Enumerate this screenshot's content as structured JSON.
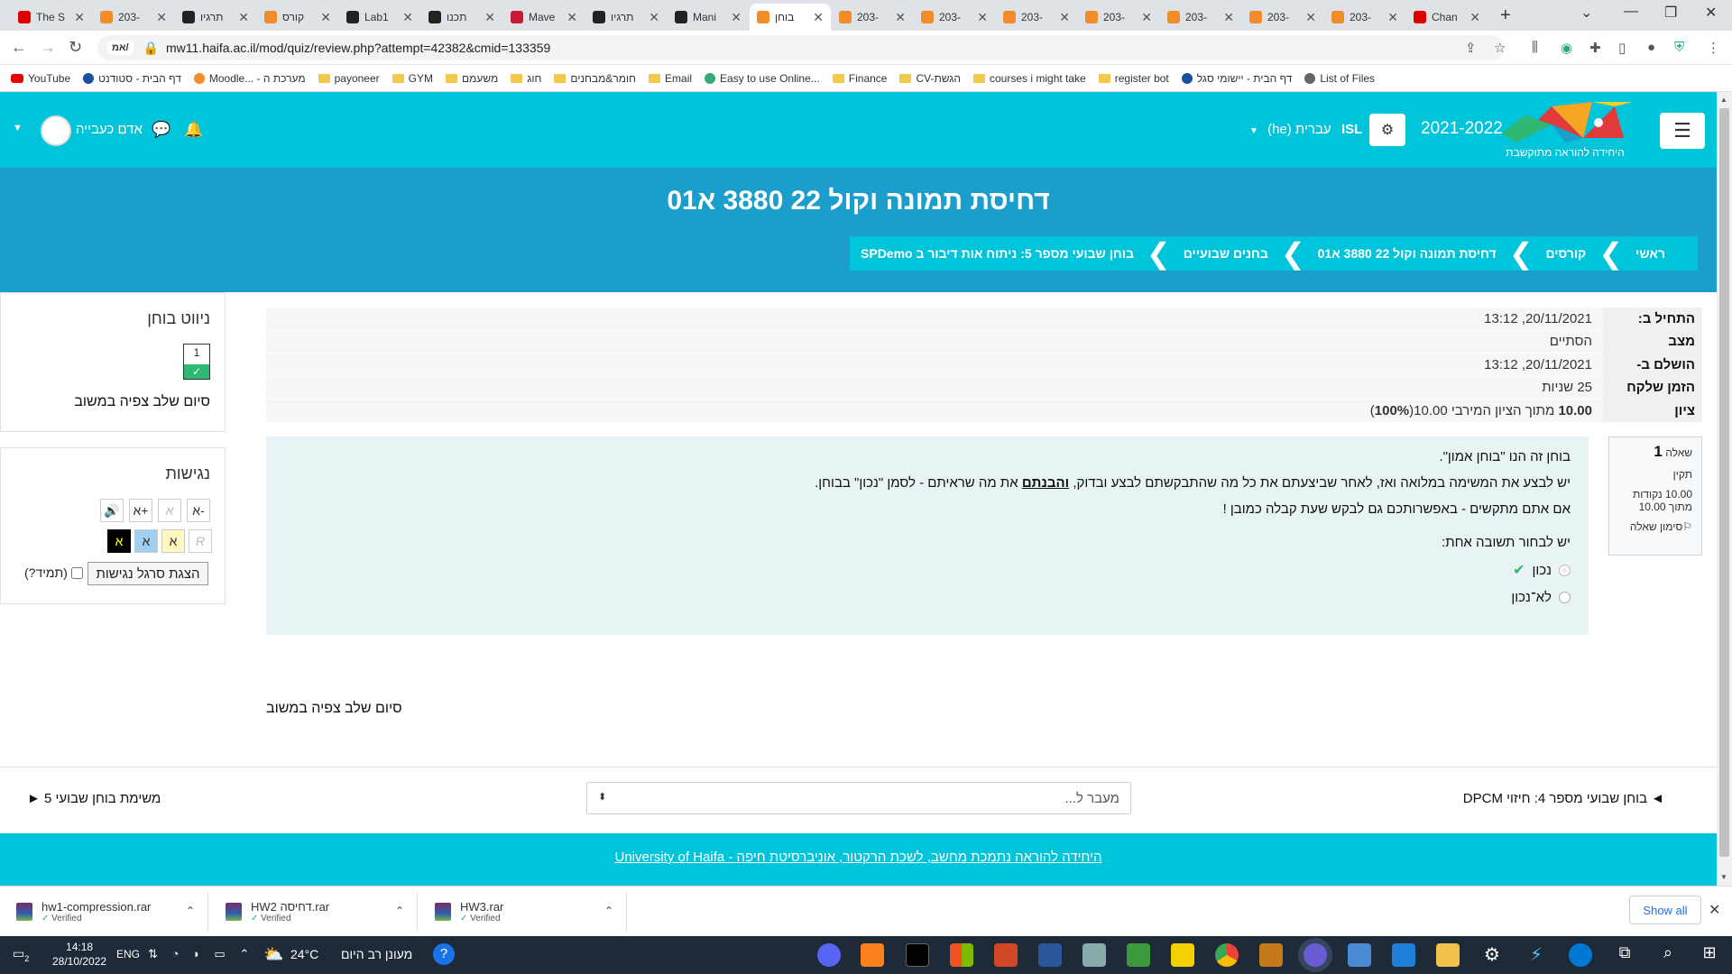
{
  "browser": {
    "tabs": [
      {
        "title": "The S",
        "icon": "youtube-icon",
        "color": "#e00000"
      },
      {
        "title": "203-",
        "icon": "moodle-icon",
        "color": "#f28c28"
      },
      {
        "title": "תרגיו",
        "icon": "github-icon",
        "color": "#222222"
      },
      {
        "title": "קורס",
        "icon": "moodle-icon",
        "color": "#f28c28"
      },
      {
        "title": "Lab1",
        "icon": "github-icon",
        "color": "#222222"
      },
      {
        "title": "תכנו",
        "icon": "github-icon",
        "color": "#222222"
      },
      {
        "title": "Mave",
        "icon": "maven-icon",
        "color": "#c71a36"
      },
      {
        "title": "תרגיו",
        "icon": "github-icon",
        "color": "#222222"
      },
      {
        "title": "Mani",
        "icon": "github-icon",
        "color": "#222222"
      },
      {
        "title": "בוחן",
        "icon": "moodle-icon",
        "color": "#f28c28",
        "active": true
      },
      {
        "title": "203-",
        "icon": "moodle-icon",
        "color": "#f28c28"
      },
      {
        "title": "203-",
        "icon": "moodle-icon",
        "color": "#f28c28"
      },
      {
        "title": "203-",
        "icon": "moodle-icon",
        "color": "#f28c28"
      },
      {
        "title": "203-",
        "icon": "moodle-icon",
        "color": "#f28c28"
      },
      {
        "title": "203-",
        "icon": "moodle-icon",
        "color": "#f28c28"
      },
      {
        "title": "203-",
        "icon": "moodle-icon",
        "color": "#f28c28"
      },
      {
        "title": "203-",
        "icon": "moodle-icon",
        "color": "#f28c28"
      },
      {
        "title": "Chan",
        "icon": "youtube-icon",
        "color": "#e00000"
      }
    ],
    "url": "mw11.haifa.ac.il/mod/quiz/review.php?attempt=42382&cmid=133359",
    "site_label": "אמ/",
    "bookmarks": [
      {
        "label": "YouTube",
        "icon": "youtube-icon"
      },
      {
        "label": "דף הבית - סטודנט",
        "icon": "haifa-icon"
      },
      {
        "label": "Moodle... - מערכת ה",
        "icon": "moodle-icon"
      },
      {
        "label": "payoneer",
        "icon": "folder-icon"
      },
      {
        "label": "GYM",
        "icon": "folder-icon"
      },
      {
        "label": "משעמם",
        "icon": "folder-icon"
      },
      {
        "label": "חוג",
        "icon": "folder-icon"
      },
      {
        "label": "חומר&מבחנים",
        "icon": "folder-icon"
      },
      {
        "label": "Email",
        "icon": "folder-icon"
      },
      {
        "label": "Easy to use Online...",
        "icon": "web-icon"
      },
      {
        "label": "Finance",
        "icon": "folder-icon"
      },
      {
        "label": "CV-הגשת",
        "icon": "folder-icon"
      },
      {
        "label": "courses i might take",
        "icon": "folder-icon"
      },
      {
        "label": "register bot",
        "icon": "folder-icon"
      },
      {
        "label": "דף הבית - יישומי סגל",
        "icon": "haifa-icon"
      },
      {
        "label": "List of Files",
        "icon": "globe-icon"
      }
    ]
  },
  "header": {
    "logo_text": "היחידה להוראה מתוקשבת",
    "year": "2021-2022",
    "isl": "ISL",
    "language": "עברית (he)",
    "username": "אדם כעבייה",
    "course_title": "דחיסת תמונה וקול 22 3880 א01",
    "breadcrumb": [
      "ראשי",
      "קורסים",
      "דחיסת תמונה וקול 22 3880 א01",
      "בחנים שבועיים",
      "בוחן שבועי מספר 5: ניתוח אות דיבור ב SPDemo"
    ]
  },
  "sidebar": {
    "nav_title": "ניווט בוחן",
    "question_number": "1",
    "finish_review": "סיום שלב צפיה במשוב",
    "accessibility_title": "נגישות",
    "font_minus": "א-",
    "font_plain": "א",
    "font_plus": "א+",
    "contrast": [
      "R",
      "א",
      "א",
      "א"
    ],
    "toolbar_button": "הצגת סרגל נגישות",
    "always_label": "(תמיד?)"
  },
  "summary": [
    {
      "label": "התחיל ב:",
      "value": "20/11/2021, 13:12"
    },
    {
      "label": "מצב",
      "value": "הסתיים"
    },
    {
      "label": "הושלם ב-",
      "value": "20/11/2021, 13:12"
    },
    {
      "label": "הזמן שלקח",
      "value": "25 שניות"
    },
    {
      "label": "ציון",
      "value_bold": "10.00",
      "value_rest": "מתוך הציון המירבי 10.00(",
      "value_pct": "100%",
      "value_end": ")"
    }
  ],
  "question": {
    "label": "שאלה",
    "number": "1",
    "status": "תקין",
    "marks": "10.00 נקודות",
    "marks_out_of": "מתוך 10.00",
    "flag": "סימון שאלה",
    "line1": "בוחן זה הנו \"בוחן אמון\".",
    "line2_a": "יש לבצע את המשימה במלואה ואז, לאחר שביצעתם את כל מה שהתבקשתם לבצע ובדוק, ",
    "line2_b": "והבנתם",
    "line2_c": " את מה שראיתם - לסמן \"נכון\" בבוחן.",
    "line3": "אם אתם מתקשים - באפשרותכם גם לבקש שעת קבלה כמובן !",
    "prompt": "יש לבחור תשובה אחת:",
    "options": [
      {
        "label": "נכון",
        "selected": true,
        "correct": true
      },
      {
        "label": "לא־נכון",
        "selected": false,
        "correct": false
      }
    ]
  },
  "finish_review": "סיום שלב צפיה במשוב",
  "activity_nav": {
    "prev": "◄ בוחן שבועי מספר 4: חיזוי DPCM",
    "jump_placeholder": "מעבר ל...",
    "next": "משימת בוחן שבועי 5 ►"
  },
  "footer": "היחידה להוראה נתמכת מחשב, לשכת הרקטור, אוניברסיטת חיפה - University of Haifa",
  "downloads": [
    {
      "name": "hw1-compression.rar",
      "status": "Verified"
    },
    {
      "name": "HW2 דחיסה.rar",
      "status": "Verified"
    },
    {
      "name": "HW3.rar",
      "status": "Verified"
    }
  ],
  "downloads_show_all": "Show all",
  "taskbar": {
    "time": "14:18",
    "date": "28/10/2022",
    "lang": "ENG",
    "weather_temp": "24°C",
    "weather_desc": "מעונן רב היום",
    "badge": "2"
  },
  "colors": {
    "header": "#00c4da",
    "hero": "#1b9ecb",
    "correct": "#2eb872"
  }
}
